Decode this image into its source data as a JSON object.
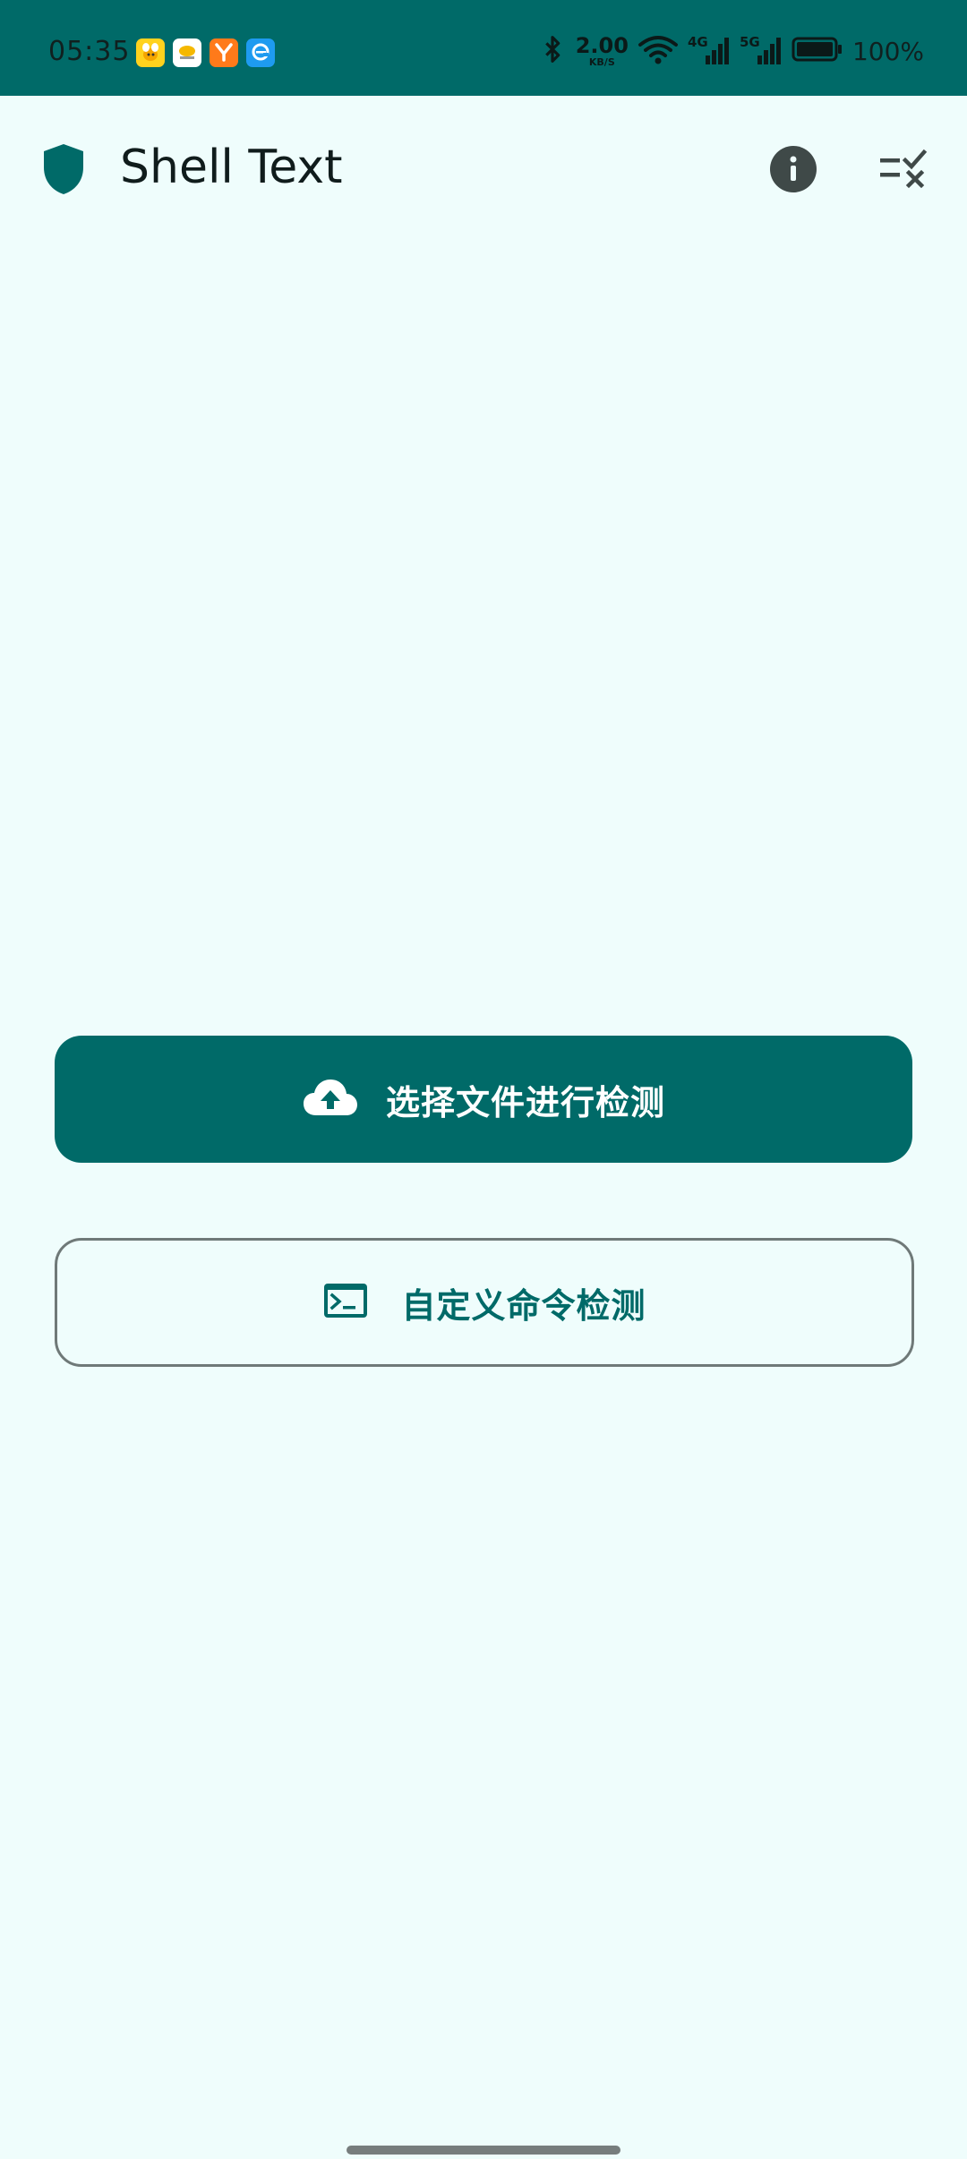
{
  "status_bar": {
    "time": "05:35",
    "net_speed_value": "2.00",
    "net_speed_unit": "KB/S",
    "network_4g": "4G",
    "network_5g": "5G",
    "battery_percent": "100%",
    "notification_icons": [
      "bee-app-icon",
      "cloud-app-icon",
      "y-app-icon",
      "e-app-icon"
    ]
  },
  "app_bar": {
    "title": "Shell Text",
    "logo_icon": "shield-icon",
    "actions": [
      "info-icon",
      "checklist-icon"
    ]
  },
  "main": {
    "primary_button_label": "选择文件进行检测",
    "outline_button_label": "自定义命令检测"
  },
  "colors": {
    "accent": "#006a68",
    "background": "#effdfc",
    "outline": "#6f7978"
  }
}
